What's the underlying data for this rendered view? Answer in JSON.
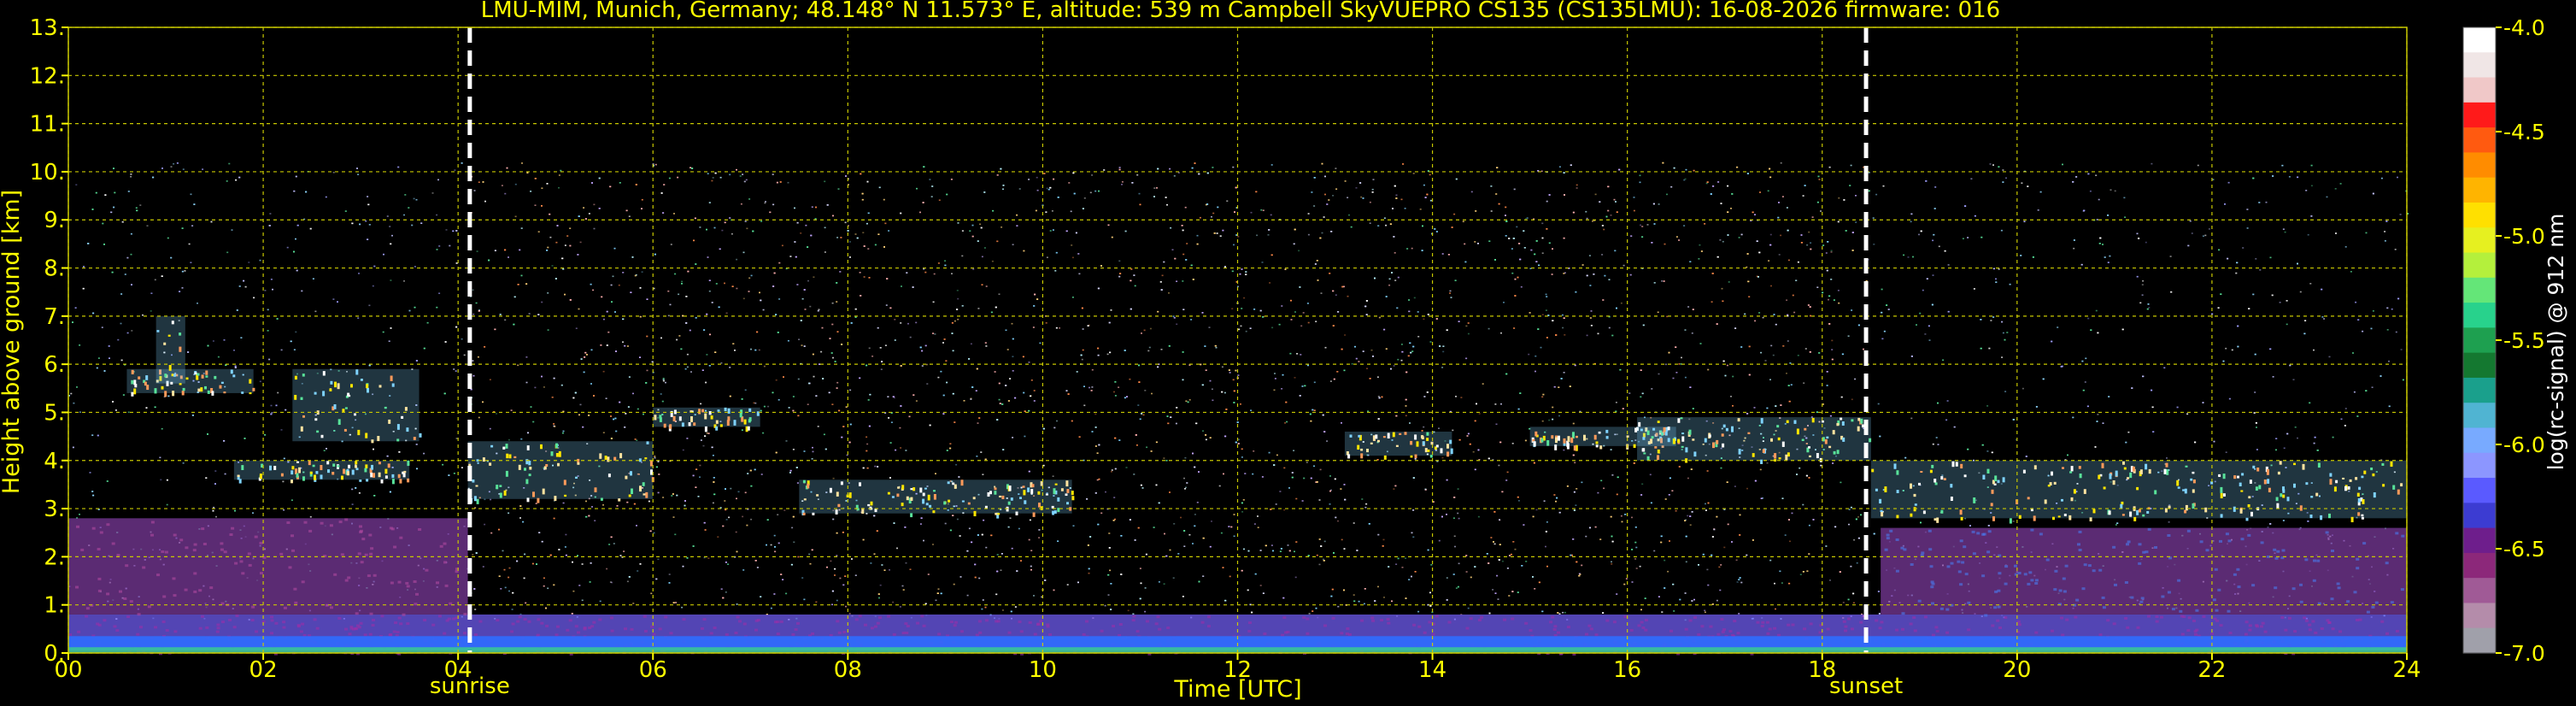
{
  "chart_data": {
    "type": "heatmap",
    "title": "LMU-MIM, Munich, Germany; 48.148° N 11.573° E, altitude: 539 m    Campbell SkyVUEPRO CS135 (CS135LMU): 16-08-2026    firmware: 016",
    "xlabel": "Time [UTC]",
    "ylabel": "Height above ground [km]",
    "colorbar_label": "log(rc-signal) @ 912 nm",
    "xlim": [
      0,
      24
    ],
    "ylim": [
      0,
      13
    ],
    "x_ticks": [
      0,
      2,
      4,
      6,
      8,
      10,
      12,
      14,
      16,
      18,
      20,
      22,
      24
    ],
    "x_tick_labels": [
      "00",
      "02",
      "04",
      "06",
      "08",
      "10",
      "12",
      "14",
      "16",
      "18",
      "20",
      "22",
      "24"
    ],
    "y_ticks": [
      0,
      1,
      2,
      3,
      4,
      5,
      6,
      7,
      8,
      9,
      10,
      11,
      12,
      13
    ],
    "y_tick_labels": [
      "0.",
      "1.",
      "2.",
      "3.",
      "4.",
      "5.",
      "6.",
      "7.",
      "8.",
      "9.",
      "10.",
      "11.",
      "12.",
      "13."
    ],
    "grid": true,
    "colorbar": {
      "range": [
        -7.0,
        -4.0
      ],
      "tick_values": [
        -4.0,
        -4.5,
        -5.0,
        -5.5,
        -6.0,
        -6.5,
        -7.0
      ],
      "tick_labels": [
        "-4.0",
        "-4.5",
        "-5.0",
        "-5.5",
        "-6.0",
        "-6.5",
        "-7.0"
      ]
    },
    "annotations": [
      {
        "text": "sunrise",
        "x": 4.12
      },
      {
        "text": "sunset",
        "x": 18.45
      }
    ],
    "signal_top_km": 10.2,
    "layers": [
      {
        "name": "aerosol boundary layer",
        "start": 0,
        "end": 24,
        "base_km": 0,
        "top_km": 0.8
      },
      {
        "name": "residual layer night",
        "start": 0,
        "end": 4.1,
        "base_km": 0.8,
        "top_km": 2.8
      },
      {
        "name": "residual layer evening",
        "start": 18.6,
        "end": 24,
        "base_km": 0.8,
        "top_km": 2.6
      },
      {
        "name": "cloud",
        "start": 0.6,
        "end": 1.9,
        "base_km": 5.4,
        "top_km": 5.9
      },
      {
        "name": "cloud",
        "start": 0.9,
        "end": 1.2,
        "base_km": 5.6,
        "top_km": 7.0
      },
      {
        "name": "cloud",
        "start": 2.3,
        "end": 3.6,
        "base_km": 4.4,
        "top_km": 5.9
      },
      {
        "name": "cloud",
        "start": 1.7,
        "end": 3.5,
        "base_km": 3.6,
        "top_km": 4.0
      },
      {
        "name": "cloud",
        "start": 4.1,
        "end": 6.0,
        "base_km": 3.2,
        "top_km": 4.4
      },
      {
        "name": "cloud",
        "start": 6.0,
        "end": 7.1,
        "base_km": 4.7,
        "top_km": 5.1
      },
      {
        "name": "cloud",
        "start": 7.5,
        "end": 10.3,
        "base_km": 2.9,
        "top_km": 3.6
      },
      {
        "name": "cloud",
        "start": 13.1,
        "end": 14.2,
        "base_km": 4.1,
        "top_km": 4.6
      },
      {
        "name": "cloud",
        "start": 15.0,
        "end": 16.5,
        "base_km": 4.3,
        "top_km": 4.7
      },
      {
        "name": "cloud",
        "start": 16.1,
        "end": 18.5,
        "base_km": 4.0,
        "top_km": 4.9
      },
      {
        "name": "cloud",
        "start": 18.5,
        "end": 24,
        "base_km": 2.8,
        "top_km": 4.0
      }
    ]
  },
  "colors": {
    "background": "#000000",
    "text": "#ffff00",
    "grid": "#c8c800",
    "sun_lines": "#ffffff",
    "colorbar_label": "#ffffff"
  }
}
